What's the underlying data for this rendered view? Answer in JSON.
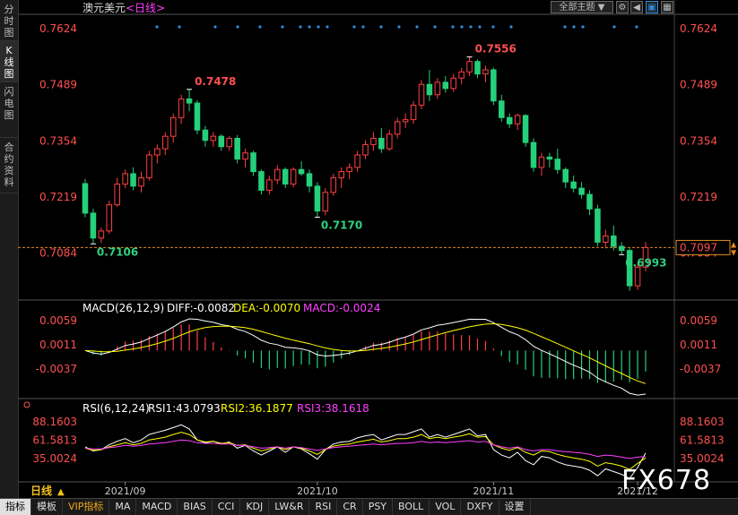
{
  "left_tabs": [
    {
      "label": "分时图",
      "active": false
    },
    {
      "label": "K线图",
      "active": true
    },
    {
      "label": "闪电图",
      "active": false
    },
    {
      "label": "合约资料",
      "active": false
    }
  ],
  "header": {
    "symbol": "澳元美元",
    "period": "<日线>",
    "theme_select": "全部主题",
    "theme_arrow": "▼"
  },
  "price_panel": {
    "y_ticks": [
      "0.7624",
      "0.7489",
      "0.7354",
      "0.7219",
      "0.7084"
    ],
    "last_price": "0.7097",
    "labels": {
      "high1": "0.7478",
      "high2": "0.7556",
      "low1": "0.7106",
      "low2": "0.7170",
      "low3": "0.6993"
    }
  },
  "macd": {
    "name": "MACD(26,12,9)",
    "diff": "DIFF:-0.0082",
    "dea": "DEA:-0.0070",
    "macd": "MACD:-0.0024",
    "y_ticks": [
      "0.0059",
      "0.0011",
      "-0.0037"
    ]
  },
  "rsi": {
    "name": "RSI(6,12,24)",
    "rsi1": "RSI1:43.0793",
    "rsi2": "RSI2:36.1877",
    "rsi3": "RSI3:38.1618",
    "y_ticks": [
      "88.1603",
      "61.5813",
      "35.0024"
    ]
  },
  "x_axis": {
    "period_label": "日线",
    "period_arrow": "▲",
    "dates": [
      "2021/09",
      "2021/10",
      "2021/11",
      "2021/12"
    ]
  },
  "bottom_tabs": [
    "指标",
    "模板",
    "VIP指标",
    "MA",
    "MACD",
    "BIAS",
    "CCI",
    "KDJ",
    "LW&R",
    "RSI",
    "CR",
    "PSY",
    "BOLL",
    "VOL",
    "DXFY",
    "设置"
  ],
  "watermark": "FX678",
  "colors": {
    "up": "#ff4040",
    "down": "#25d07a",
    "price_axis": "#ff5050",
    "diff": "#ffffff",
    "dea": "#ffff00",
    "macd_label": "#ff40ff",
    "rsi1": "#ffffff",
    "rsi2": "#ffff00",
    "rsi3": "#ff40ff",
    "marker": "#2e8bde"
  },
  "chart_data": {
    "type": "candlestick",
    "series_label": "澳元美元 日线",
    "ylim": [
      0.6975,
      0.765
    ],
    "y_ticks": [
      0.7624,
      0.7489,
      0.7354,
      0.7219,
      0.7084
    ],
    "candles": [
      [
        0.7251,
        0.7262,
        0.717,
        0.718
      ],
      [
        0.718,
        0.719,
        0.7106,
        0.712
      ],
      [
        0.712,
        0.7145,
        0.7108,
        0.7137
      ],
      [
        0.7137,
        0.721,
        0.713,
        0.72
      ],
      [
        0.72,
        0.7265,
        0.7195,
        0.725
      ],
      [
        0.725,
        0.7285,
        0.724,
        0.7275
      ],
      [
        0.7275,
        0.729,
        0.7235,
        0.7245
      ],
      [
        0.7245,
        0.728,
        0.723,
        0.7265
      ],
      [
        0.7265,
        0.733,
        0.7258,
        0.732
      ],
      [
        0.732,
        0.7345,
        0.73,
        0.7335
      ],
      [
        0.7335,
        0.7375,
        0.732,
        0.7365
      ],
      [
        0.7365,
        0.742,
        0.735,
        0.741
      ],
      [
        0.741,
        0.7465,
        0.7395,
        0.7455
      ],
      [
        0.7455,
        0.7478,
        0.7425,
        0.7445
      ],
      [
        0.7445,
        0.7452,
        0.737,
        0.738
      ],
      [
        0.738,
        0.739,
        0.734,
        0.7355
      ],
      [
        0.7355,
        0.7375,
        0.734,
        0.7365
      ],
      [
        0.7365,
        0.737,
        0.733,
        0.734
      ],
      [
        0.734,
        0.7365,
        0.733,
        0.736
      ],
      [
        0.736,
        0.7368,
        0.73,
        0.731
      ],
      [
        0.731,
        0.7335,
        0.729,
        0.7325
      ],
      [
        0.7325,
        0.733,
        0.727,
        0.728
      ],
      [
        0.728,
        0.7285,
        0.7225,
        0.7235
      ],
      [
        0.7235,
        0.727,
        0.7225,
        0.726
      ],
      [
        0.726,
        0.7295,
        0.725,
        0.7285
      ],
      [
        0.7285,
        0.729,
        0.724,
        0.725
      ],
      [
        0.725,
        0.729,
        0.7242,
        0.7285
      ],
      [
        0.7285,
        0.7305,
        0.727,
        0.7275
      ],
      [
        0.7275,
        0.7285,
        0.723,
        0.7245
      ],
      [
        0.7245,
        0.7255,
        0.717,
        0.7185
      ],
      [
        0.7185,
        0.724,
        0.7175,
        0.723
      ],
      [
        0.723,
        0.7275,
        0.7222,
        0.7265
      ],
      [
        0.7265,
        0.729,
        0.724,
        0.728
      ],
      [
        0.728,
        0.73,
        0.7262,
        0.729
      ],
      [
        0.729,
        0.733,
        0.728,
        0.732
      ],
      [
        0.732,
        0.7355,
        0.731,
        0.7345
      ],
      [
        0.7345,
        0.7375,
        0.733,
        0.736
      ],
      [
        0.736,
        0.7385,
        0.7325,
        0.7335
      ],
      [
        0.7335,
        0.738,
        0.733,
        0.737
      ],
      [
        0.737,
        0.741,
        0.736,
        0.74
      ],
      [
        0.74,
        0.742,
        0.7385,
        0.7405
      ],
      [
        0.7405,
        0.745,
        0.7395,
        0.744
      ],
      [
        0.744,
        0.75,
        0.743,
        0.749
      ],
      [
        0.749,
        0.7525,
        0.745,
        0.7465
      ],
      [
        0.7465,
        0.7505,
        0.7455,
        0.7495
      ],
      [
        0.7495,
        0.751,
        0.747,
        0.748
      ],
      [
        0.748,
        0.7515,
        0.7472,
        0.7505
      ],
      [
        0.7505,
        0.753,
        0.749,
        0.752
      ],
      [
        0.752,
        0.7556,
        0.751,
        0.7545
      ],
      [
        0.7545,
        0.755,
        0.7505,
        0.7515
      ],
      [
        0.7515,
        0.7535,
        0.7495,
        0.7525
      ],
      [
        0.7525,
        0.753,
        0.744,
        0.745
      ],
      [
        0.745,
        0.7465,
        0.74,
        0.741
      ],
      [
        0.741,
        0.742,
        0.7385,
        0.7395
      ],
      [
        0.7395,
        0.742,
        0.738,
        0.7415
      ],
      [
        0.7415,
        0.7418,
        0.734,
        0.735
      ],
      [
        0.735,
        0.736,
        0.728,
        0.729
      ],
      [
        0.729,
        0.7325,
        0.727,
        0.7315
      ],
      [
        0.7315,
        0.7325,
        0.729,
        0.731
      ],
      [
        0.731,
        0.7335,
        0.7275,
        0.7285
      ],
      [
        0.7285,
        0.729,
        0.724,
        0.7255
      ],
      [
        0.7255,
        0.727,
        0.723,
        0.724
      ],
      [
        0.724,
        0.7255,
        0.7215,
        0.7225
      ],
      [
        0.7225,
        0.7235,
        0.7175,
        0.719
      ],
      [
        0.719,
        0.72,
        0.71,
        0.711
      ],
      [
        0.711,
        0.714,
        0.7095,
        0.7125
      ],
      [
        0.7125,
        0.715,
        0.709,
        0.71
      ],
      [
        0.71,
        0.711,
        0.708,
        0.709
      ],
      [
        0.709,
        0.7095,
        0.6993,
        0.7005
      ],
      [
        0.7005,
        0.706,
        0.6995,
        0.705
      ],
      [
        0.705,
        0.711,
        0.704,
        0.7097
      ]
    ],
    "rsi1": [
      52,
      46,
      48,
      55,
      60,
      64,
      58,
      62,
      70,
      73,
      76,
      80,
      84,
      78,
      62,
      58,
      60,
      56,
      59,
      50,
      54,
      46,
      40,
      46,
      52,
      44,
      52,
      49,
      42,
      34,
      48,
      56,
      59,
      60,
      65,
      68,
      70,
      62,
      66,
      70,
      70,
      74,
      78,
      66,
      70,
      66,
      70,
      74,
      78,
      68,
      70,
      48,
      40,
      36,
      44,
      32,
      26,
      38,
      36,
      30,
      26,
      24,
      22,
      18,
      10,
      20,
      16,
      12,
      6,
      22,
      43
    ],
    "rsi2": [
      50,
      47,
      48,
      52,
      55,
      58,
      55,
      57,
      62,
      64,
      66,
      70,
      73,
      70,
      62,
      59,
      60,
      57,
      58,
      54,
      55,
      50,
      46,
      49,
      52,
      48,
      52,
      50,
      46,
      41,
      48,
      53,
      55,
      56,
      59,
      61,
      63,
      59,
      61,
      64,
      64,
      66,
      70,
      64,
      66,
      64,
      66,
      68,
      71,
      66,
      67,
      55,
      50,
      47,
      51,
      44,
      40,
      46,
      45,
      41,
      38,
      36,
      34,
      31,
      24,
      29,
      27,
      24,
      19,
      28,
      36
    ],
    "rsi3": [
      50,
      49,
      49,
      51,
      52,
      54,
      53,
      54,
      56,
      57,
      58,
      60,
      62,
      61,
      58,
      57,
      57,
      56,
      56,
      54,
      54,
      52,
      50,
      51,
      52,
      50,
      52,
      51,
      49,
      47,
      49,
      51,
      52,
      53,
      54,
      55,
      56,
      55,
      56,
      57,
      57,
      58,
      60,
      58,
      59,
      58,
      59,
      60,
      61,
      59,
      60,
      55,
      52,
      50,
      52,
      48,
      46,
      48,
      48,
      46,
      45,
      44,
      43,
      41,
      38,
      40,
      39,
      37,
      35,
      37,
      38
    ]
  }
}
